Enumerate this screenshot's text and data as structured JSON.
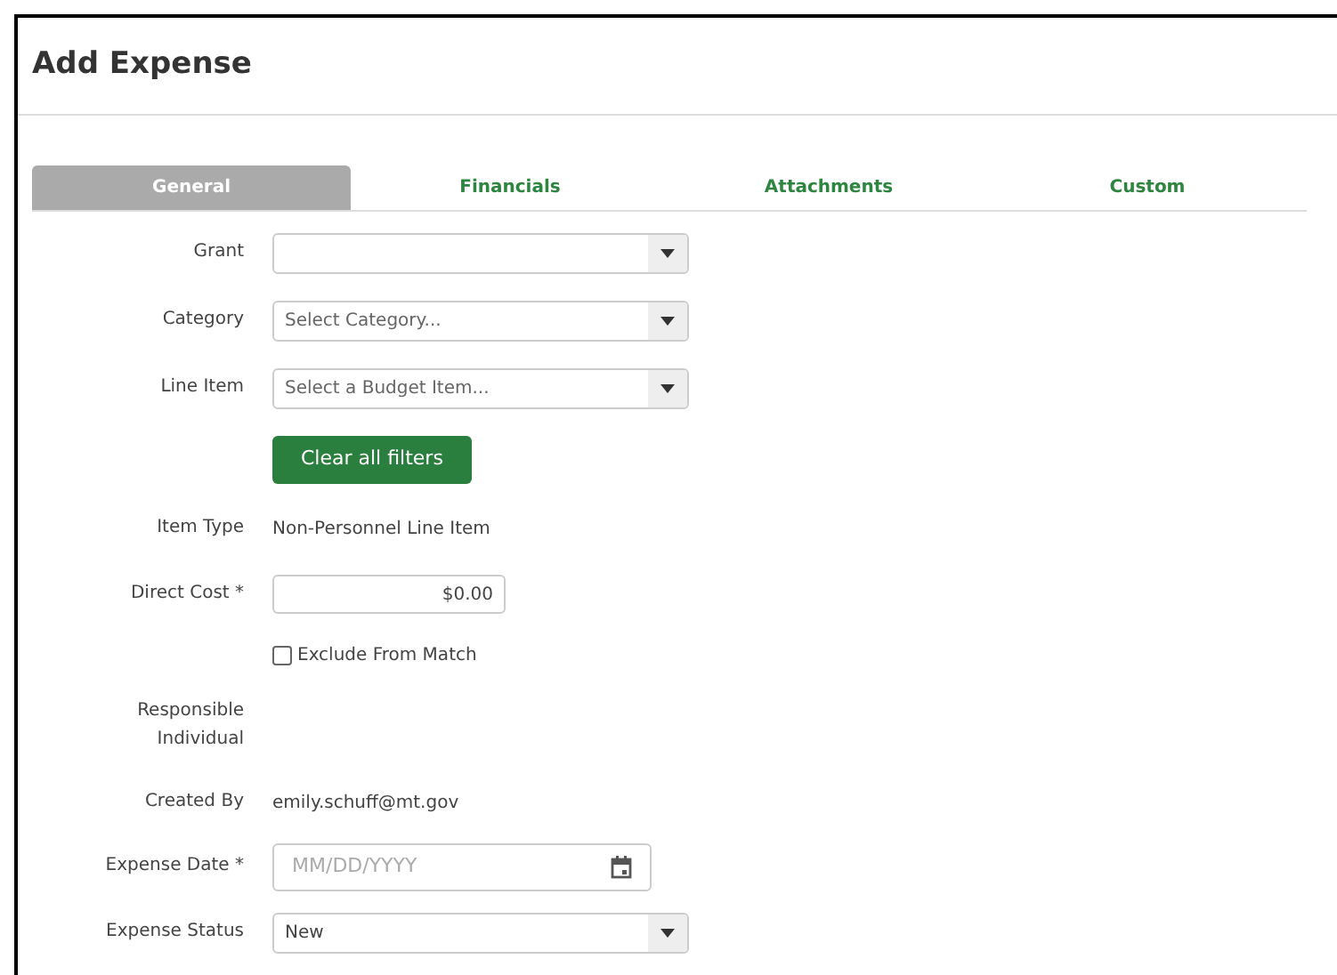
{
  "title": "Add Expense",
  "tabs": [
    {
      "label": "General",
      "selected": true
    },
    {
      "label": "Financials",
      "selected": false
    },
    {
      "label": "Attachments",
      "selected": false
    },
    {
      "label": "Custom",
      "selected": false
    }
  ],
  "fields": [
    {
      "kind": "select",
      "label": "Grant"
    },
    {
      "kind": "select",
      "label": "Category",
      "placeholder": "Select Category..."
    },
    {
      "kind": "select",
      "label": "Line Item",
      "placeholder": "Select a Budget Item..."
    },
    {
      "kind": "button",
      "text": "Clear all filters"
    },
    {
      "kind": "static",
      "label": "Item Type",
      "value": "Non-Personnel Line Item"
    },
    {
      "kind": "input",
      "label": "Direct Cost *",
      "value": "$0.00"
    },
    {
      "kind": "checkbox",
      "text": "Exclude From Match",
      "checked": false
    },
    {
      "kind": "static",
      "label": "Responsible Individual"
    },
    {
      "kind": "static",
      "label": "Created By",
      "value": "emily.schuff@mt.gov"
    },
    {
      "kind": "date",
      "label": "Expense Date *",
      "placeholder": "MM/DD/YYYY"
    },
    {
      "kind": "select",
      "label": "Expense Status",
      "value": "New"
    }
  ]
}
